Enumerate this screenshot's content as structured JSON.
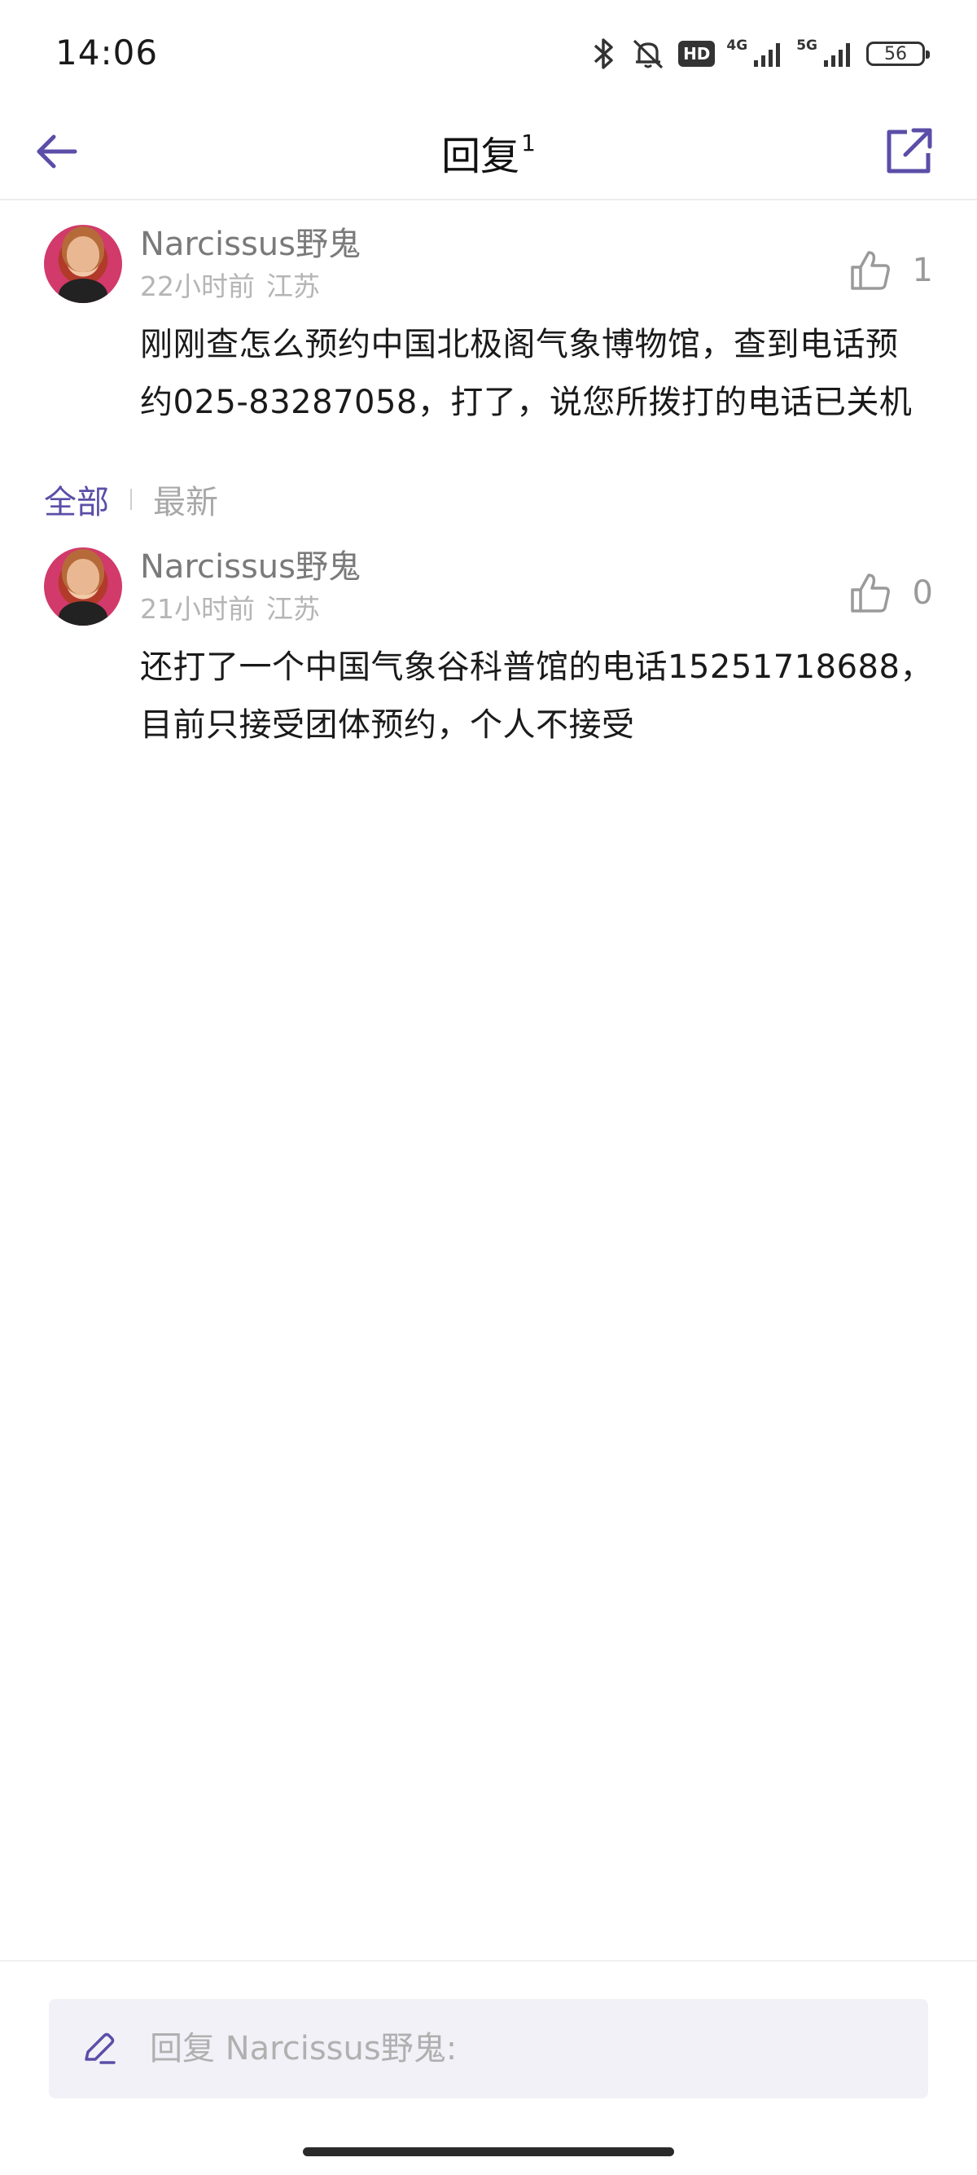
{
  "status_bar": {
    "time": "14:06",
    "hd_label": "HD",
    "net1": "4G",
    "net2": "5G",
    "battery": "56"
  },
  "header": {
    "title": "回复",
    "count": "1"
  },
  "root_comment": {
    "username": "Narcissus野鬼",
    "time": "22小时前",
    "location": "江苏",
    "likes": "1",
    "lines": [
      "刚刚查怎么预约中国北极阁气象博物馆，查到电话预",
      "约025-83287058，打了，说您所拨打的电话已关机"
    ]
  },
  "tabs": {
    "all": "全部",
    "latest": "最新"
  },
  "replies": [
    {
      "username": "Narcissus野鬼",
      "time": "21小时前",
      "location": "江苏",
      "likes": "0",
      "lines": [
        "还打了一个中国气象谷科普馆的电话15251718688，",
        "目前只接受团体预约，个人不接受"
      ]
    }
  ],
  "reply_box": {
    "placeholder": "回复 Narcissus野鬼:"
  },
  "colors": {
    "accent": "#5a4ea8",
    "muted_text": "#b5b5b5",
    "input_bg": "#f2f1f7"
  },
  "icons": {
    "back": "arrow-left-icon",
    "share": "share-external-icon",
    "like": "thumbs-up-icon",
    "edit": "pencil-icon"
  }
}
